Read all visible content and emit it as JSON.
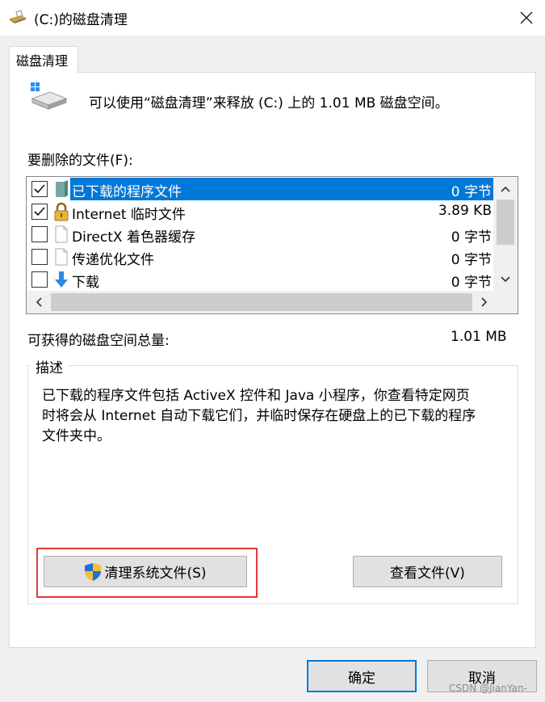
{
  "window": {
    "title": "(C:)的磁盘清理"
  },
  "tab": {
    "label": "磁盘清理"
  },
  "intro": {
    "text": "可以使用“磁盘清理”来释放  (C:) 上的 1.01 MB 磁盘空间。"
  },
  "files_label": "要删除的文件(F):",
  "file_list": [
    {
      "name": "已下载的程序文件",
      "size": "0 字节",
      "checked": true,
      "selected": true,
      "icon": "folder-icon"
    },
    {
      "name": "Internet 临时文件",
      "size": "3.89 KB",
      "checked": true,
      "selected": false,
      "icon": "lock-icon"
    },
    {
      "name": "DirectX 着色器缓存",
      "size": "0 字节",
      "checked": false,
      "selected": false,
      "icon": "file-icon"
    },
    {
      "name": "传递优化文件",
      "size": "0 字节",
      "checked": false,
      "selected": false,
      "icon": "file-icon"
    },
    {
      "name": "下载",
      "size": "0 字节",
      "checked": false,
      "selected": false,
      "icon": "download-arrow-icon"
    }
  ],
  "total": {
    "label": "可获得的磁盘空间总量:",
    "value": "1.01 MB"
  },
  "description": {
    "label": "描述",
    "lines": [
      "已下载的程序文件包括 ActiveX 控件和 Java 小程序，你查看特定网页",
      "时将会从 Internet 自动下载它们，并临时保存在硬盘上的已下载的程序",
      "文件夹中。"
    ]
  },
  "buttons": {
    "clean_system": "清理系统文件(S)",
    "view_files": "查看文件(V)",
    "ok": "确定",
    "cancel": "取消"
  },
  "watermark": "CSDN @JianYan-",
  "colors": {
    "selection": "#0078d7",
    "highlight_box": "#e03a3a"
  }
}
